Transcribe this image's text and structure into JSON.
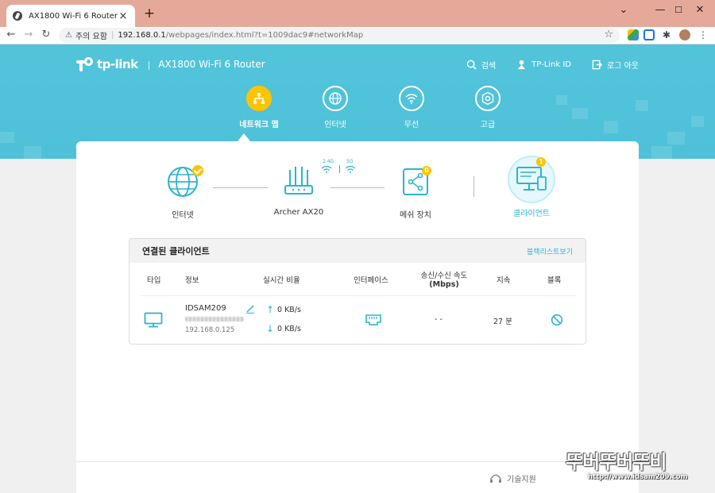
{
  "browser": {
    "tab_title": "AX1800 Wi-Fi 6 Router",
    "new_tab": "+",
    "omnibox_warning": "주의 요함",
    "url_host": "192.168.0.1",
    "url_path": "/webpages/index.html?t=1009dac9#networkMap",
    "window_buttons": [
      "⌄",
      "—",
      "☐",
      "✕"
    ]
  },
  "header": {
    "brand_logo": "tp-link",
    "brand_separator": "|",
    "model": "AX1800 Wi-Fi 6 Router",
    "links": {
      "search": "검색",
      "tplink_id": "TP-Link ID",
      "logout": "로그 아웃"
    }
  },
  "nav": {
    "items": [
      {
        "label": "네트워크 맵",
        "icon": "network-map-icon",
        "active": true
      },
      {
        "label": "인터넷",
        "icon": "globe-icon"
      },
      {
        "label": "무선",
        "icon": "wifi-icon"
      },
      {
        "label": "고급",
        "icon": "gear-icon"
      }
    ]
  },
  "topology": {
    "internet": "인터넷",
    "router": "Archer AX20",
    "band_24": "2.4G",
    "band_5": "5G",
    "mesh": "메쉬 장치",
    "mesh_count": "0",
    "clients": "클라이언트",
    "client_count": "1"
  },
  "clients_panel": {
    "title": "연결된 클라이언트",
    "blacklist_link": "블랙리스트보기",
    "columns": {
      "type": "타입",
      "info": "정보",
      "rate": "실시간 비율",
      "interface": "인터페이스",
      "speed": "송신/수신 속도",
      "speed_unit": "(Mbps)",
      "duration": "지속",
      "block": "블록"
    },
    "rows": [
      {
        "name": "IDSAM209",
        "ip": "192.168.0.125",
        "upload": "0 KB/s",
        "download": "0 KB/s",
        "speed": "- -",
        "duration": "27 분"
      }
    ]
  },
  "footer": {
    "support": "기술지원",
    "watermark_big": "뚜버뚜버뚜비",
    "watermark_url": "http://www.idsam209.com"
  },
  "colors": {
    "accent": "#2bb4d0",
    "hero": "#4ec1d9",
    "active_nav": "#ffc400",
    "tabstrip": "#e5a99a"
  }
}
